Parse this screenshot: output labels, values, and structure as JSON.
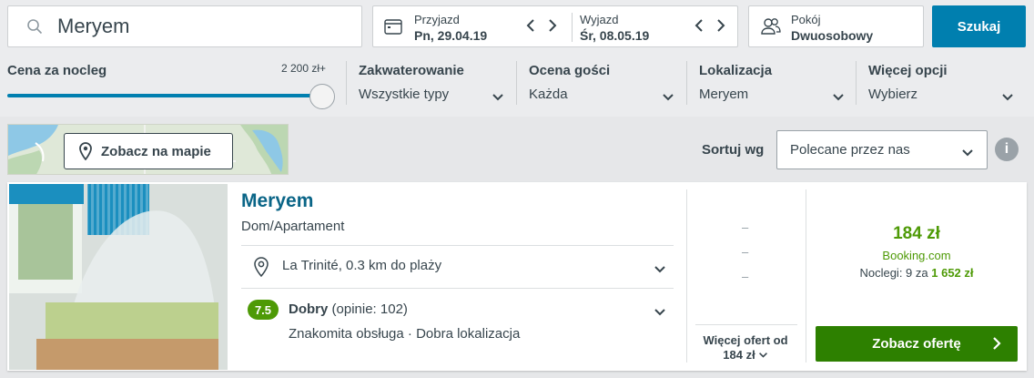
{
  "search": {
    "query": "Meryem"
  },
  "dates": {
    "checkin_label": "Przyjazd",
    "checkin_value": "Pn, 29.04.19",
    "checkout_label": "Wyjazd",
    "checkout_value": "Śr, 08.05.19"
  },
  "room": {
    "label": "Pokój",
    "value": "Dwuosobowy"
  },
  "search_button": "Szukaj",
  "filters": {
    "price": {
      "label": "Cena za nocleg",
      "max": "2 200 zł+",
      "level_fraction": 1.0
    },
    "accommodation": {
      "label": "Zakwaterowanie",
      "value": "Wszystkie typy"
    },
    "rating": {
      "label": "Ocena gości",
      "value": "Każda"
    },
    "location": {
      "label": "Lokalizacja",
      "value": "Meryem"
    },
    "more": {
      "label": "Więcej opcji",
      "value": "Wybierz"
    }
  },
  "map": {
    "button_label": "Zobacz na mapie"
  },
  "sort": {
    "label": "Sortuj wg",
    "value": "Polecane przez nas"
  },
  "result": {
    "name": "Meryem",
    "type": "Dom/Apartament",
    "location": "La Trinité, 0.3 km do plaży",
    "rating_score": "7.5",
    "rating_word": "Dobry",
    "rating_count": "(opinie: 102)",
    "highlights": "Znakomita obsługa · Dobra lokalizacja",
    "dashes": [
      "–",
      "–",
      "–"
    ],
    "more_offers_line1": "Więcej ofert od",
    "more_offers_line2": "184 zł",
    "price": "184 zł",
    "provider": "Booking.com",
    "nights_prefix": "Noclegi: 9 za",
    "nights_total": "1 652 zł",
    "deal_button": "Zobacz ofertę"
  },
  "colors": {
    "brand_blue": "#007faf",
    "hotel_name": "#0a6587",
    "green": "#4e9a06",
    "deal_button": "#2d8000"
  }
}
